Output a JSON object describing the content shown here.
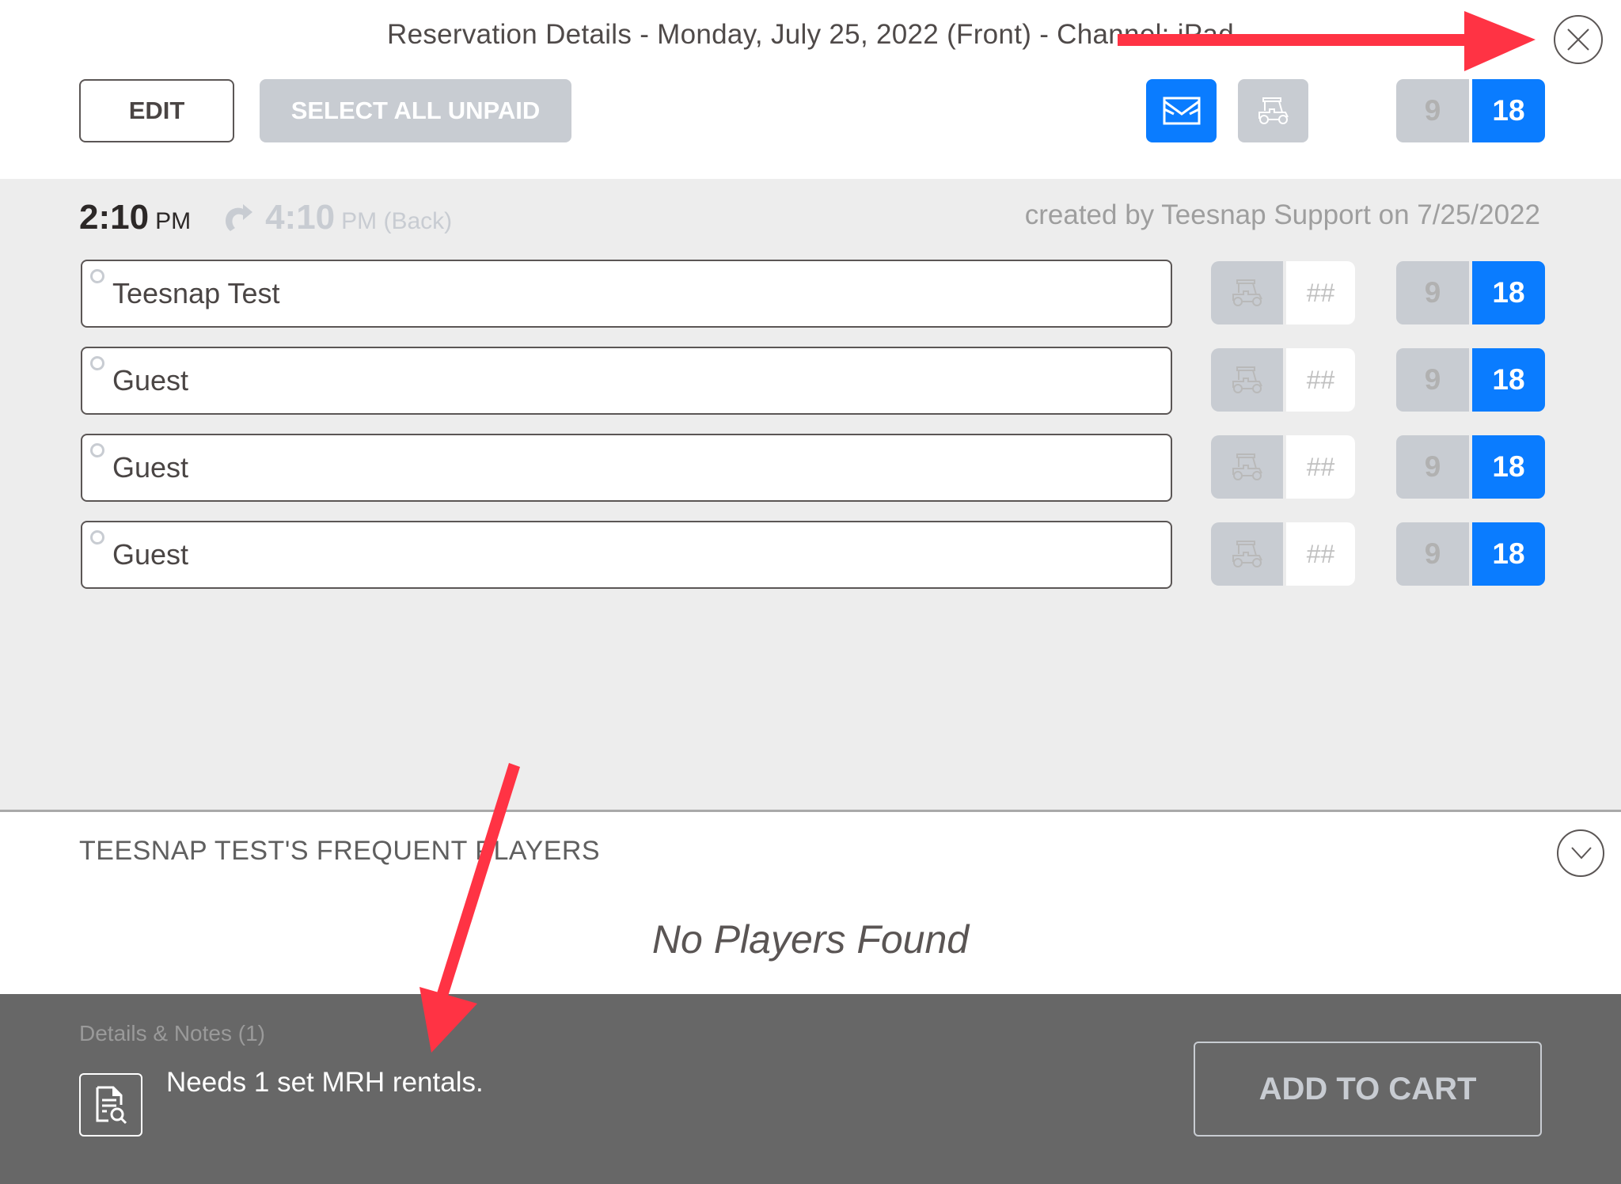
{
  "header": {
    "title": "Reservation Details - Monday, July 25, 2022 (Front) - Channel: iPad",
    "edit_label": "EDIT",
    "select_all_unpaid_label": "SELECT ALL UNPAID",
    "holes": {
      "nine": "9",
      "eighteen": "18",
      "selected": "18"
    }
  },
  "reservation": {
    "time": "2:10",
    "time_ampm": "PM",
    "back_time": "4:10",
    "back_ampm": "PM (Back)",
    "created_by": "created by Teesnap Support on 7/25/2022"
  },
  "players": [
    {
      "name": "Teesnap Test",
      "cart_number_placeholder": "##",
      "holes_nine": "9",
      "holes_eighteen": "18",
      "selected_holes": "18"
    },
    {
      "name": "Guest",
      "cart_number_placeholder": "##",
      "holes_nine": "9",
      "holes_eighteen": "18",
      "selected_holes": "18"
    },
    {
      "name": "Guest",
      "cart_number_placeholder": "##",
      "holes_nine": "9",
      "holes_eighteen": "18",
      "selected_holes": "18"
    },
    {
      "name": "Guest",
      "cart_number_placeholder": "##",
      "holes_nine": "9",
      "holes_eighteen": "18",
      "selected_holes": "18"
    }
  ],
  "frequent_players": {
    "title": "TEESNAP TEST'S FREQUENT PLAYERS",
    "empty_message": "No Players Found"
  },
  "footer": {
    "notes_label": "Details & Notes (1)",
    "note_text": "Needs 1 set MRH rentals.",
    "add_to_cart_label": "ADD TO CART"
  },
  "colors": {
    "accent_blue": "#0a7cff",
    "disabled_gray": "#c8ccd2",
    "annotation_red": "#ff3344",
    "footer_bg": "#676767"
  }
}
